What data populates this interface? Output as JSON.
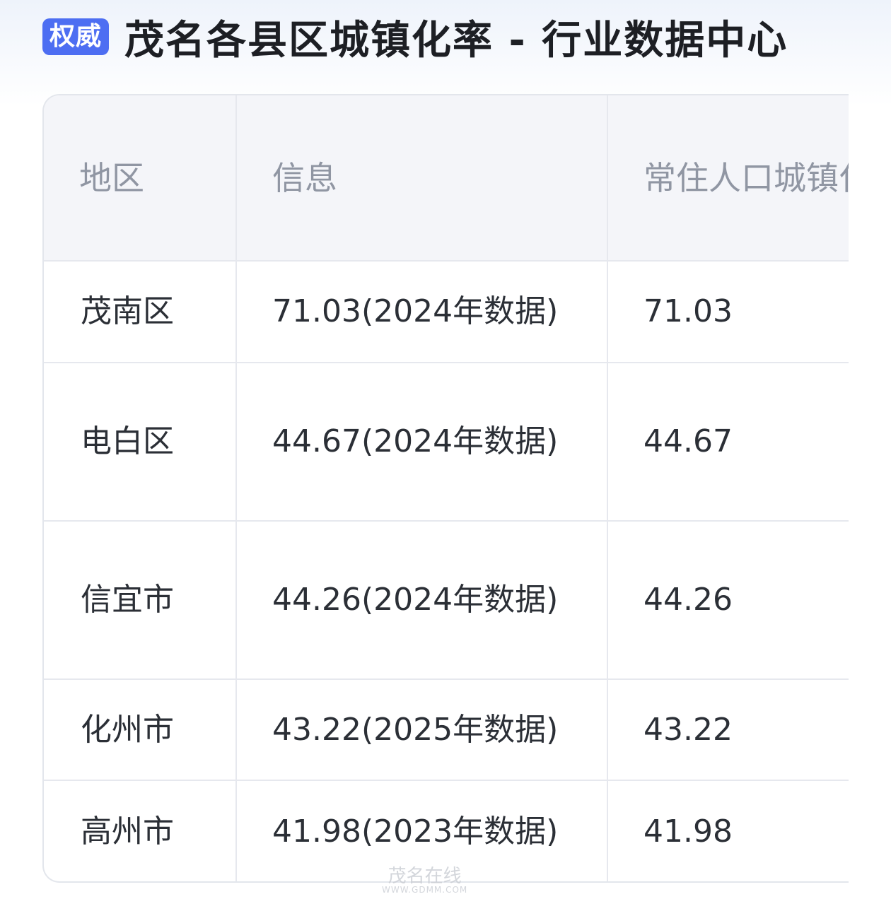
{
  "header": {
    "badge": "权威",
    "title": "茂名各县区城镇化率 - 行业数据中心"
  },
  "table": {
    "columns": [
      "地区",
      "信息",
      "常住人口城镇化率(%)"
    ],
    "rows": [
      {
        "region": "茂南区",
        "info": "71.03(2024年数据)",
        "rate": "71.03"
      },
      {
        "region": "电白区",
        "info": "44.67(2024年数据)",
        "rate": "44.67"
      },
      {
        "region": "信宜市",
        "info": "44.26(2024年数据)",
        "rate": "44.26"
      },
      {
        "region": "化州市",
        "info": "43.22(2025年数据)",
        "rate": "43.22"
      },
      {
        "region": "高州市",
        "info": "41.98(2023年数据)",
        "rate": "41.98"
      }
    ]
  },
  "watermark": {
    "text": "茂名在线",
    "url": "WWW.GDMM.COM"
  },
  "colors": {
    "badge_bg": "#4d6ef2",
    "header_bg": "#f4f5f9",
    "border": "#e6e8ee"
  }
}
